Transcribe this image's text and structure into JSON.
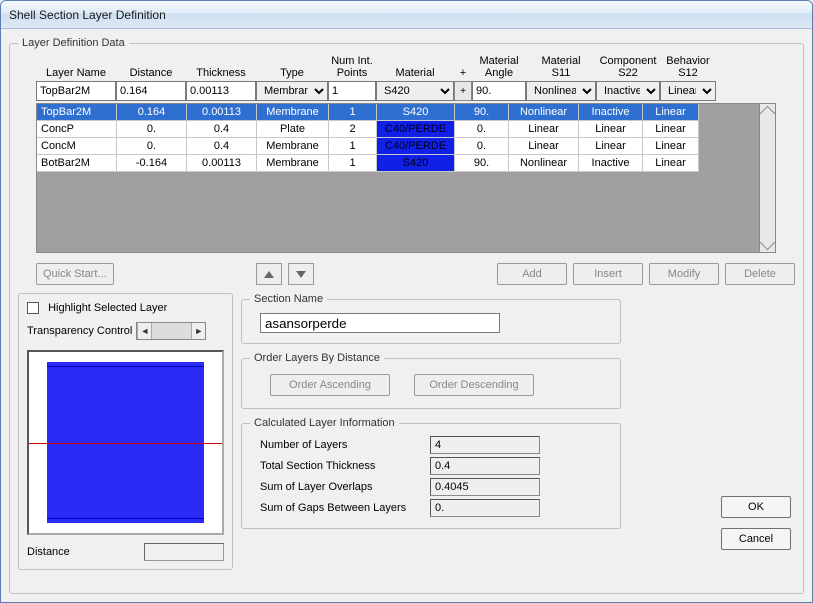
{
  "window": {
    "title": "Shell Section Layer Definition"
  },
  "mainGroup": {
    "legend": "Layer Definition Data"
  },
  "headers": {
    "name": "Layer Name",
    "distance": "Distance",
    "thickness": "Thickness",
    "type": "Type",
    "numint": "Num Int.\nPoints",
    "material": "Material",
    "matplus": "+",
    "angle": "Material\nAngle",
    "s11": "Material\nS11",
    "s22": "Component\nS22",
    "s12": "Behavior\nS12"
  },
  "inputs": {
    "name": "TopBar2M",
    "distance": "0.164",
    "thickness": "0.00113",
    "type": "Membrane",
    "numint": "1",
    "material": "S420",
    "angle": "90.",
    "s11": "Nonlinear",
    "s22": "Inactive",
    "s12": "Linear"
  },
  "rows": [
    {
      "name": "TopBar2M",
      "distance": "0.164",
      "thickness": "0.00113",
      "type": "Membrane",
      "numint": "1",
      "material": "S420",
      "angle": "90.",
      "s11": "Nonlinear",
      "s22": "Inactive",
      "s12": "Linear",
      "selected": true,
      "bluemat": false
    },
    {
      "name": "ConcP",
      "distance": "0.",
      "thickness": "0.4",
      "type": "Plate",
      "numint": "2",
      "material": "C40/PERDE",
      "angle": "0.",
      "s11": "Linear",
      "s22": "Linear",
      "s12": "Linear",
      "selected": false,
      "bluemat": true
    },
    {
      "name": "ConcM",
      "distance": "0.",
      "thickness": "0.4",
      "type": "Membrane",
      "numint": "1",
      "material": "C40/PERDE",
      "angle": "0.",
      "s11": "Linear",
      "s22": "Linear",
      "s12": "Linear",
      "selected": false,
      "bluemat": true
    },
    {
      "name": "BotBar2M",
      "distance": "-0.164",
      "thickness": "0.00113",
      "type": "Membrane",
      "numint": "1",
      "material": "S420",
      "angle": "90.",
      "s11": "Nonlinear",
      "s22": "Inactive",
      "s12": "Linear",
      "selected": false,
      "bluemat": true
    }
  ],
  "actions": {
    "quickstart": "Quick Start...",
    "add": "Add",
    "insert": "Insert",
    "modify": "Modify",
    "delete": "Delete"
  },
  "highlight": {
    "label": "Highlight Selected Layer"
  },
  "transparency": {
    "label": "Transparency Control"
  },
  "distanceLabel": "Distance",
  "section": {
    "legend": "Section Name",
    "value": "asansorperde"
  },
  "order": {
    "legend": "Order Layers By Distance",
    "asc": "Order Ascending",
    "desc": "Order Descending"
  },
  "calc": {
    "legend": "Calculated Layer Information",
    "numlayers": {
      "label": "Number of Layers",
      "value": "4"
    },
    "totalthick": {
      "label": "Total Section Thickness",
      "value": "0.4"
    },
    "overlaps": {
      "label": "Sum of Layer Overlaps",
      "value": "0.4045"
    },
    "gaps": {
      "label": "Sum of Gaps Between Layers",
      "value": "0."
    }
  },
  "ok": "OK",
  "cancel": "Cancel"
}
